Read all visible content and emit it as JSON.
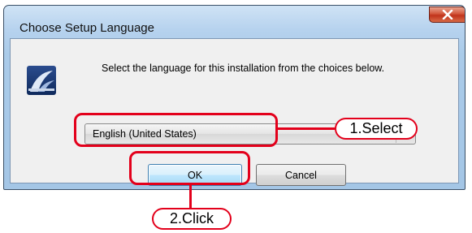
{
  "window": {
    "title": "Choose Setup Language",
    "close_glyph": "x",
    "icon": "installer-icon"
  },
  "dialog": {
    "prompt": "Select the language for this installation from the choices below.",
    "language_select": {
      "value": "English (United States)"
    },
    "buttons": {
      "ok_label": "OK",
      "cancel_label": "Cancel"
    }
  },
  "annotations": {
    "step1": "1.Select",
    "step2": "2.Click",
    "highlight_color": "#e3001b"
  }
}
